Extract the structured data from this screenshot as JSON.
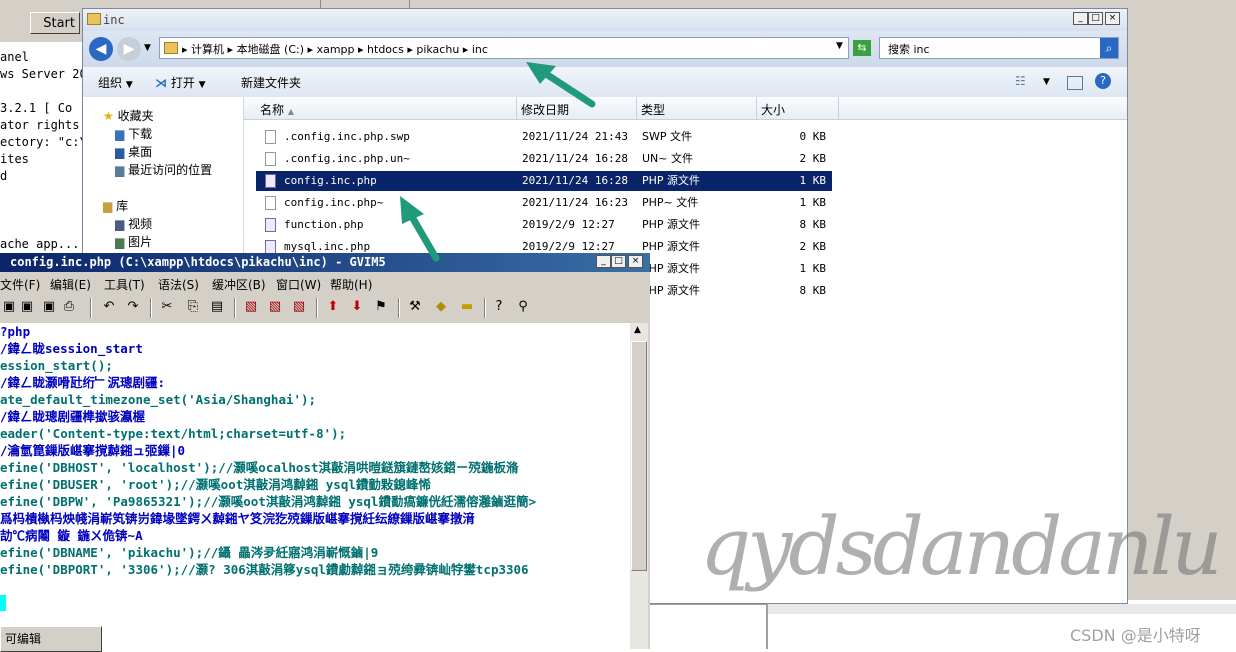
{
  "background": {
    "start_label": "Start",
    "console_lines": [
      "anel",
      "ws Server 20",
      "",
      "3.2.1 [ Co",
      "ator rights",
      "ectory: \"c:\\",
      "ites",
      "d",
      "",
      "",
      "ache app..."
    ],
    "bottom_button": "可编辑"
  },
  "explorer": {
    "title": "inc",
    "address": [
      "计算机",
      "本地磁盘 (C:)",
      "xampp",
      "htdocs",
      "pikachu",
      "inc"
    ],
    "search_placeholder": "搜索 inc",
    "toolbar": {
      "organize": "组织",
      "open": "打开",
      "new_folder": "新建文件夹"
    },
    "nav": {
      "favorites": "收藏夹",
      "downloads": "下载",
      "desktop": "桌面",
      "recent": "最近访问的位置",
      "libraries": "库",
      "videos": "视频",
      "pictures": "图片"
    },
    "columns": [
      "名称",
      "修改日期",
      "类型",
      "大小"
    ],
    "files": [
      {
        "name": ".config.inc.php.swp",
        "date": "2021/11/24 21:43",
        "type": "SWP 文件",
        "size": "0 KB"
      },
      {
        "name": ".config.inc.php.un~",
        "date": "2021/11/24 16:28",
        "type": "UN~ 文件",
        "size": "2 KB"
      },
      {
        "name": "config.inc.php",
        "date": "2021/11/24 16:28",
        "type": "PHP 源文件",
        "size": "1 KB"
      },
      {
        "name": "config.inc.php~",
        "date": "2021/11/24 16:23",
        "type": "PHP~ 文件",
        "size": "1 KB"
      },
      {
        "name": "function.php",
        "date": "2019/2/9 12:27",
        "type": "PHP 源文件",
        "size": "8 KB"
      },
      {
        "name": "mysql.inc.php",
        "date": "2019/2/9 12:27",
        "type": "PHP 源文件",
        "size": "2 KB"
      },
      {
        "name": "",
        "date": "",
        "type": "PHP 源文件",
        "size": "1 KB"
      },
      {
        "name": "",
        "date": "",
        "type": "PHP 源文件",
        "size": "8 KB"
      }
    ]
  },
  "gvim": {
    "title": "config.inc.php (C:\\xampp\\htdocs\\pikachu\\inc) - GVIM5",
    "menus": [
      "文件(F)",
      "编辑(E)",
      "工具(T)",
      "语法(S)",
      "缓冲区(B)",
      "窗口(W)",
      "帮助(H)"
    ],
    "code": [
      "?php",
      "/鍏ㄥ眬session_start",
      "ession_start();",
      "/鍏ㄥ眬灏嗗瓧绗﹂泦璁剧疆:",
      "ate_default_timezone_set('Asia/Shanghai');",
      "/鍏ㄥ眬璁剧疆榫撳骇瀛楃",
      "eader('Content-type:text/html;charset=utf-8');",
      "/瀹氫箟鏁版嵁搴撹繛鎺ュ弬鏁|0",
      "efine('DBHOST', 'localhost');//灏嗘ocalhost淇敼涓哄暟鎹簱鏈嶅姟鍣ㄧ殑鍦板潃",
      "efine('DBUSER', 'root');//灏嗘oot淇敼涓鸿繛鎺  ysql鐨勭敤鎴峰悕",
      "efine('DBPW', 'Pa9865321');//灏嗘oot淇敼涓鸿繛鎺  ysql鐨勫瘑鐮侊紝濡傛灉鏀逛簡>",
      "爲杩樻槸杩炴帴涓嶄笂锛岃鍏堟墜鍔ㄨ繛鎺ヤ笅浣犵殑鏁版嵁搴撹紝纭繚鏁版嵁搴撴湇",
      "劼℃病闂 鏇  鍦ㄨ佹锛~A",
      "efine('DBNAME', 'pikachu');//鑷  畾涔夛紝寤鸿涓嶄慨鏀|9",
      "efine('DBPORT', '3306');//灏? 306淇敼涓簃ysql鐨勮繛鎺ョ殑绔彛锛屾牸鐢tcp3306"
    ]
  },
  "watermark": "qydsdandanlu",
  "csdn_credit": "CSDN @是小特呀"
}
